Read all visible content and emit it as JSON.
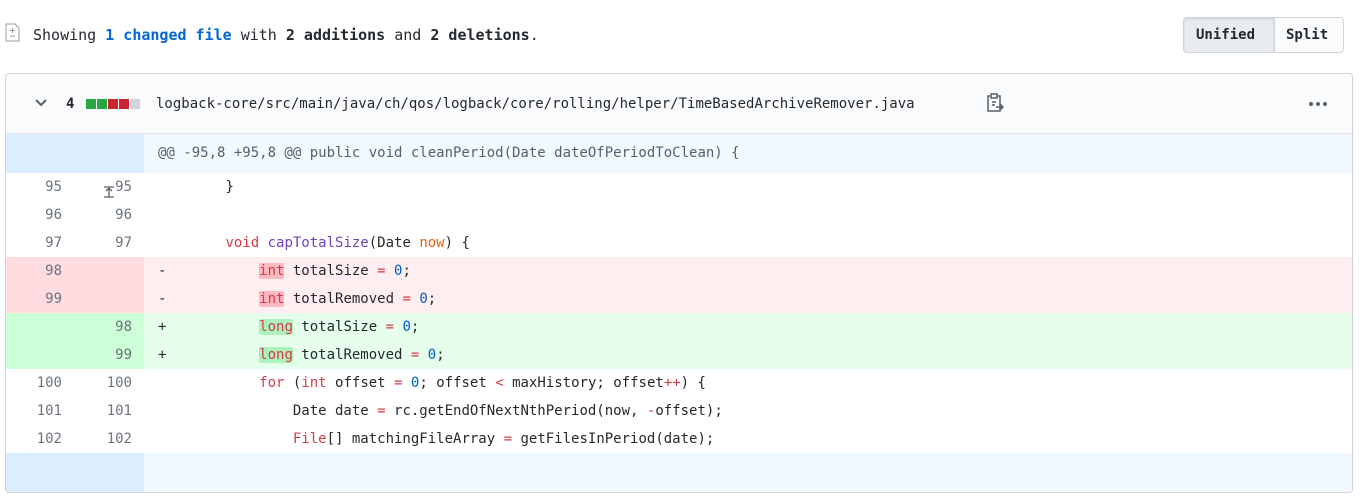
{
  "summary": {
    "prefix": "Showing ",
    "changed": "1 changed file",
    "mid": " with ",
    "additions": "2 additions",
    "and": " and ",
    "deletions": "2 deletions",
    "suffix": "."
  },
  "view_toggle": {
    "unified": "Unified",
    "split": "Split"
  },
  "file": {
    "diff_count": "4",
    "path": "logback-core/src/main/java/ch/qos/logback/core/rolling/helper/TimeBasedArchiveRemover.java",
    "diffstat_colors": [
      "#28a745",
      "#28a745",
      "#cb2431",
      "#cb2431",
      "#d1d5da"
    ]
  },
  "hunk_header": "@@ -95,8 +95,8 @@ public void cleanPeriod(Date dateOfPeriodToClean) {",
  "lines": [
    {
      "old": "95",
      "new": "95",
      "mark": "",
      "indent": "        ",
      "tokens": [
        [
          "}",
          ""
        ]
      ]
    },
    {
      "old": "96",
      "new": "96",
      "mark": "",
      "indent": "",
      "tokens": []
    },
    {
      "old": "97",
      "new": "97",
      "mark": "",
      "indent": "        ",
      "tokens": [
        [
          "void",
          "kw"
        ],
        [
          " ",
          ""
        ],
        [
          "capTotalSize",
          "fn"
        ],
        [
          "(Date ",
          ""
        ],
        [
          "now",
          "var"
        ],
        [
          ") {",
          ""
        ]
      ]
    },
    {
      "old": "98",
      "new": "",
      "mark": "-",
      "indent": "            ",
      "tokens": [
        [
          "int",
          "kw hl-del"
        ],
        [
          " totalSize ",
          ""
        ],
        [
          "=",
          "kw"
        ],
        [
          " ",
          ""
        ],
        [
          "0",
          "num"
        ],
        [
          ";",
          ""
        ]
      ]
    },
    {
      "old": "99",
      "new": "",
      "mark": "-",
      "indent": "            ",
      "tokens": [
        [
          "int",
          "kw hl-del"
        ],
        [
          " totalRemoved ",
          ""
        ],
        [
          "=",
          "kw"
        ],
        [
          " ",
          ""
        ],
        [
          "0",
          "num"
        ],
        [
          ";",
          ""
        ]
      ]
    },
    {
      "old": "",
      "new": "98",
      "mark": "+",
      "indent": "            ",
      "tokens": [
        [
          "long",
          "kw hl-add"
        ],
        [
          " totalSize ",
          ""
        ],
        [
          "=",
          "kw"
        ],
        [
          " ",
          ""
        ],
        [
          "0",
          "num"
        ],
        [
          ";",
          ""
        ]
      ]
    },
    {
      "old": "",
      "new": "99",
      "mark": "+",
      "indent": "            ",
      "tokens": [
        [
          "long",
          "kw hl-add"
        ],
        [
          " totalRemoved ",
          ""
        ],
        [
          "=",
          "kw"
        ],
        [
          " ",
          ""
        ],
        [
          "0",
          "num"
        ],
        [
          ";",
          ""
        ]
      ]
    },
    {
      "old": "100",
      "new": "100",
      "mark": "",
      "indent": "            ",
      "tokens": [
        [
          "for",
          "kw"
        ],
        [
          " (",
          ""
        ],
        [
          "int",
          "kw"
        ],
        [
          " offset ",
          ""
        ],
        [
          "=",
          "kw"
        ],
        [
          " ",
          ""
        ],
        [
          "0",
          "num"
        ],
        [
          "; offset ",
          ""
        ],
        [
          "<",
          "kw"
        ],
        [
          " maxHistory; offset",
          ""
        ],
        [
          "++",
          "kw"
        ],
        [
          ") {",
          ""
        ]
      ]
    },
    {
      "old": "101",
      "new": "101",
      "mark": "",
      "indent": "                ",
      "tokens": [
        [
          "Date date ",
          ""
        ],
        [
          "=",
          "kw"
        ],
        [
          " rc.getEndOfNextNthPeriod(now, ",
          ""
        ],
        [
          "-",
          "kw"
        ],
        [
          "offset);",
          ""
        ]
      ]
    },
    {
      "old": "102",
      "new": "102",
      "mark": "",
      "indent": "                ",
      "tokens": [
        [
          "File",
          "kw"
        ],
        [
          "[] matchingFileArray ",
          ""
        ],
        [
          "=",
          "kw"
        ],
        [
          " getFilesInPeriod(date);",
          ""
        ]
      ]
    }
  ]
}
